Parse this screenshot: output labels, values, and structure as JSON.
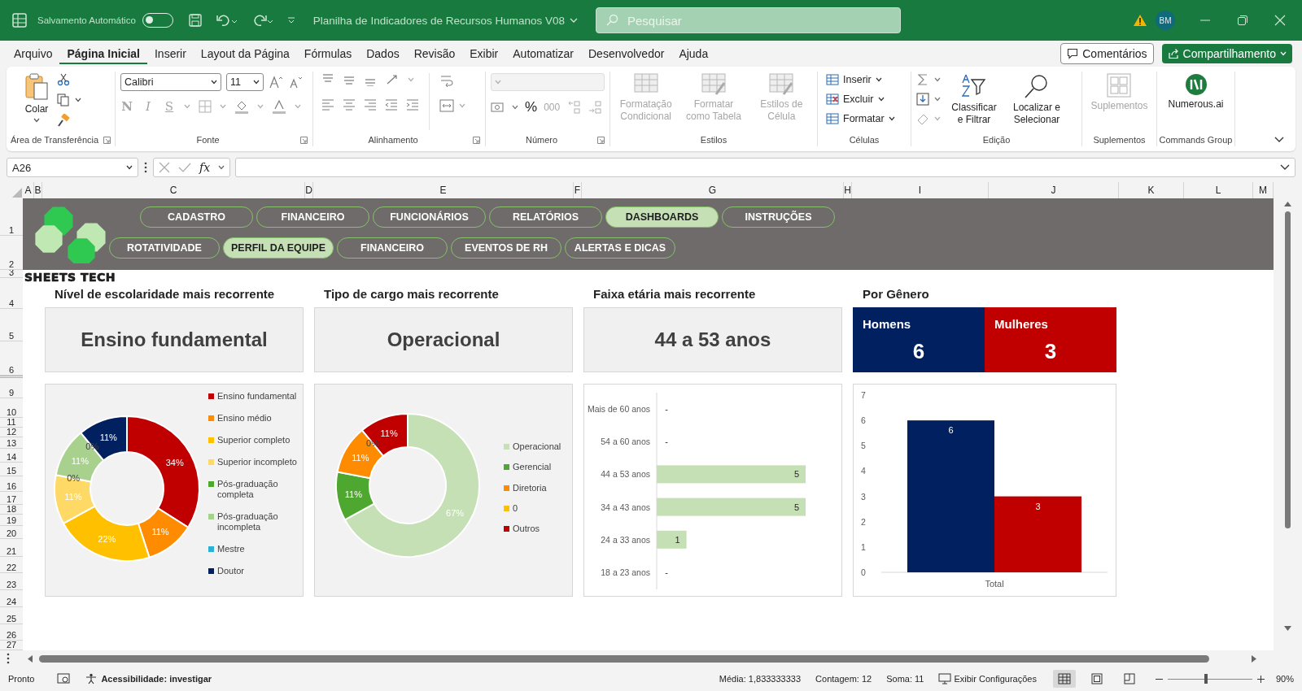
{
  "title_bar": {
    "autosave": {
      "label": "Salvamento Automático",
      "on": false
    },
    "document_title": "Planilha de Indicadores de Recursos Humanos V08",
    "search": {
      "placeholder": "Pesquisar"
    },
    "avatar": "BM"
  },
  "menu": {
    "tabs": [
      {
        "label": "Arquivo",
        "selected": false
      },
      {
        "label": "Página Inicial",
        "selected": true
      },
      {
        "label": "Inserir",
        "selected": false
      },
      {
        "label": "Layout da Página",
        "selected": false
      },
      {
        "label": "Fórmulas",
        "selected": false
      },
      {
        "label": "Dados",
        "selected": false
      },
      {
        "label": "Revisão",
        "selected": false
      },
      {
        "label": "Exibir",
        "selected": false
      },
      {
        "label": "Automatizar",
        "selected": false
      },
      {
        "label": "Desenvolvedor",
        "selected": false
      },
      {
        "label": "Ajuda",
        "selected": false
      }
    ],
    "comments": "Comentários",
    "share": "Compartilhamento"
  },
  "ribbon": {
    "clipboard": {
      "label": "Área de Transferência",
      "paste": "Colar"
    },
    "font": {
      "label": "Fonte",
      "family": "Calibri",
      "size": "11",
      "styles": [
        {
          "label": "N",
          "kind": "bold",
          "disabled": true
        },
        {
          "label": "I",
          "kind": "italic",
          "disabled": true
        },
        {
          "label": "S",
          "kind": "underline",
          "disabled": true
        }
      ]
    },
    "alignment": {
      "label": "Alinhamento"
    },
    "number": {
      "label": "Número",
      "buttons": [
        {
          "label": "%",
          "disabled": false
        },
        {
          "label": "000",
          "disabled": true
        }
      ]
    },
    "styles": {
      "label": "Estilos",
      "items": [
        {
          "label": "Formatação Condicional",
          "disabled": true
        },
        {
          "label": "Formatar como Tabela",
          "disabled": true
        },
        {
          "label": "Estilos de Célula",
          "disabled": true
        }
      ]
    },
    "cells": {
      "label": "Células",
      "items": [
        {
          "label": "Inserir",
          "kind": "insert"
        },
        {
          "label": "Excluir",
          "kind": "delete"
        },
        {
          "label": "Formatar",
          "kind": "format"
        }
      ]
    },
    "editing": {
      "label": "Edição",
      "items": [
        {
          "label": "Classificar e Filtrar",
          "kind": "sort"
        },
        {
          "label": "Localizar e Selecionar",
          "kind": "find"
        }
      ]
    },
    "addins": {
      "label": "Suplementos",
      "items": [
        {
          "label": "Suplementos",
          "disabled": true
        }
      ]
    },
    "commands": {
      "label": "Commands Group",
      "items": [
        {
          "label": "Numerous.ai",
          "disabled": false
        }
      ]
    }
  },
  "formula_bar": {
    "name_box": "A26",
    "function_label": "fx"
  },
  "column_headers": [
    "A",
    "B",
    "C",
    "D",
    "E",
    "F",
    "G",
    "H",
    "I",
    "J",
    "K",
    "L",
    "M"
  ],
  "row_headers": [
    "1",
    "2",
    "3",
    "4",
    "5",
    "6",
    "9",
    "10",
    "11",
    "12",
    "13",
    "14",
    "15",
    "16",
    "17",
    "18",
    "19",
    "20",
    "21",
    "22",
    "23",
    "24",
    "25",
    "26",
    "27"
  ],
  "banner": {
    "nav_primary": [
      {
        "label": "CADASTRO",
        "selected": false
      },
      {
        "label": "FINANCEIRO",
        "selected": false
      },
      {
        "label": "FUNCIONÁRIOS",
        "selected": false
      },
      {
        "label": "RELATÓRIOS",
        "selected": false
      },
      {
        "label": "DASHBOARDS",
        "selected": true
      },
      {
        "label": "INSTRUÇÕES",
        "selected": false
      }
    ],
    "nav_secondary": [
      {
        "label": "ROTATIVIDADE",
        "selected": false
      },
      {
        "label": "PERFIL DA EQUIPE",
        "selected": true
      },
      {
        "label": "FINANCEIRO",
        "selected": false
      },
      {
        "label": "EVENTOS DE RH",
        "selected": false
      },
      {
        "label": "ALERTAS E DICAS",
        "selected": false
      }
    ],
    "brand": "SHEETS TECH"
  },
  "dashboard": {
    "kpis": [
      {
        "title": "Nível de escolaridade mais recorrente",
        "value": "Ensino fundamental"
      },
      {
        "title": "Tipo de cargo mais recorrente",
        "value": "Operacional"
      },
      {
        "title": "Faixa etária mais recorrente",
        "value": "44 a 53 anos"
      }
    ],
    "gender": {
      "title": "Por Gênero",
      "items": [
        {
          "label": "Homens",
          "value": "6",
          "color": "#002060"
        },
        {
          "label": "Mulheres",
          "value": "3",
          "color": "#c00000"
        }
      ]
    },
    "charts": [
      {
        "slices": [
          {
            "color": "#c00000"
          },
          {
            "color": "#ff8c00"
          },
          {
            "color": "#ffc000"
          },
          {
            "color": "#ffd966"
          },
          {
            "color": "#4ea72e"
          },
          {
            "color": "#a9d18e"
          },
          {
            "color": "#2eb0d4"
          },
          {
            "color": "#002060"
          }
        ],
        "chart_data": {
          "type": "donut",
          "categories": [
            "Ensino fundamental",
            "Ensino médio",
            "Superior completo",
            "Superior incompleto",
            "Pós-graduação completa",
            "Pós-graduação incompleta",
            "Mestre",
            "Doutor"
          ],
          "values": [
            34,
            11,
            22,
            11,
            0,
            11,
            0,
            11
          ],
          "value_labels": [
            "34%",
            "11%",
            "22%",
            "11%",
            "0%",
            "11%",
            "0%",
            "11%"
          ]
        }
      },
      {
        "slices": [
          {
            "color": "#c5e0b4"
          },
          {
            "color": "#4ea72e"
          },
          {
            "color": "#ff8c00"
          },
          {
            "color": "#ffc000"
          },
          {
            "color": "#c00000"
          }
        ],
        "chart_data": {
          "type": "donut",
          "categories": [
            "Operacional",
            "Gerencial",
            "Diretoria",
            "0",
            "Outros"
          ],
          "values": [
            67,
            11,
            11,
            0,
            11
          ],
          "value_labels": [
            "67%",
            "11%",
            "11%",
            "0%",
            "11%"
          ]
        }
      },
      {
        "chart_data": {
          "type": "bar",
          "orientation": "horizontal",
          "categories": [
            "Mais de 60 anos",
            "54 a 60 anos",
            "44 a 53 anos",
            "34 a 43 anos",
            "24 a 33 anos",
            "18 a 23 anos"
          ],
          "series": [
            {
              "color": "#c5e0b4",
              "values": [
                null,
                null,
                5,
                5,
                1,
                null
              ]
            }
          ],
          "value_labels": [
            "-",
            "-",
            null,
            null,
            null,
            "-"
          ],
          "data_labels": true
        }
      },
      {
        "chart_data": {
          "type": "bar",
          "categories": [
            "Total"
          ],
          "series": [
            {
              "color": "#002060",
              "values": [
                6
              ]
            },
            {
              "color": "#c00000",
              "values": [
                3
              ]
            }
          ],
          "ylim": [
            0,
            7
          ],
          "yticks": [
            0,
            1,
            2,
            3,
            4,
            5,
            6,
            7
          ],
          "data_labels": true
        }
      }
    ]
  },
  "status_bar": {
    "ready": "Pronto",
    "accessibility": "Acessibilidade: investigar",
    "stats": [
      "Média: 1,833333333",
      "Contagem: 12",
      "Soma: 11"
    ],
    "display_settings": "Exibir Configurações",
    "views": [
      {
        "kind": "normal",
        "selected": true
      },
      {
        "kind": "page_layout",
        "selected": false
      },
      {
        "kind": "page_break",
        "selected": false
      }
    ],
    "zoom": {
      "level": 0.45,
      "label": "90%"
    }
  }
}
